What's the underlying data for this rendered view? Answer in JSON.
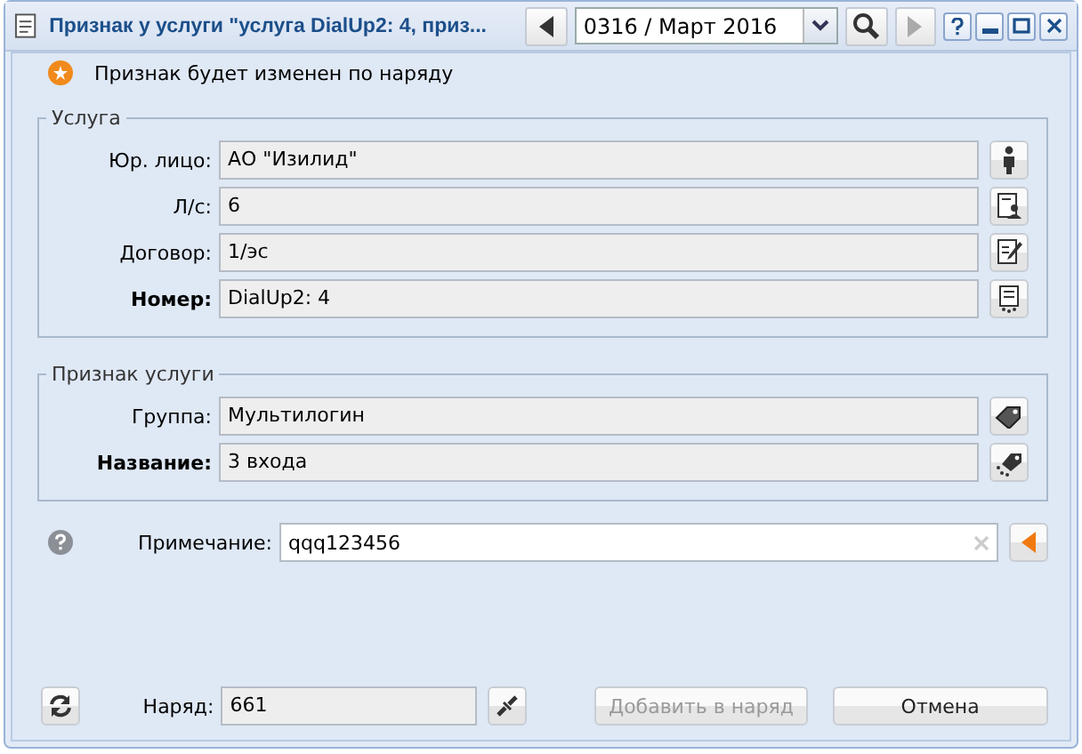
{
  "window": {
    "title": "Признак у услуги \"услуга DialUp2: 4, приз...",
    "period": "0316 / Март 2016"
  },
  "notice": "Признак будет изменен по наряду",
  "groups": [
    {
      "title": "Услуга",
      "fields": [
        {
          "label": "Юр. лицо:",
          "value": "АО \"Изилид\"",
          "bold": false
        },
        {
          "label": "Л/с:",
          "value": "6",
          "bold": false
        },
        {
          "label": "Договор:",
          "value": "1/эс",
          "bold": false
        },
        {
          "label": "Номер:",
          "value": "DialUp2: 4",
          "bold": true
        }
      ]
    },
    {
      "title": "Признак услуги",
      "fields": [
        {
          "label": "Группа:",
          "value": "Мультилогин",
          "bold": false
        },
        {
          "label": "Название:",
          "value": "3 входа",
          "bold": true
        }
      ]
    }
  ],
  "note": {
    "label": "Примечание:",
    "value": "qqq123456"
  },
  "footer": {
    "label": "Наряд:",
    "value": "661",
    "add_button": {
      "label": "Добавить в наряд",
      "disabled": true
    },
    "cancel_button": "Отмена"
  }
}
